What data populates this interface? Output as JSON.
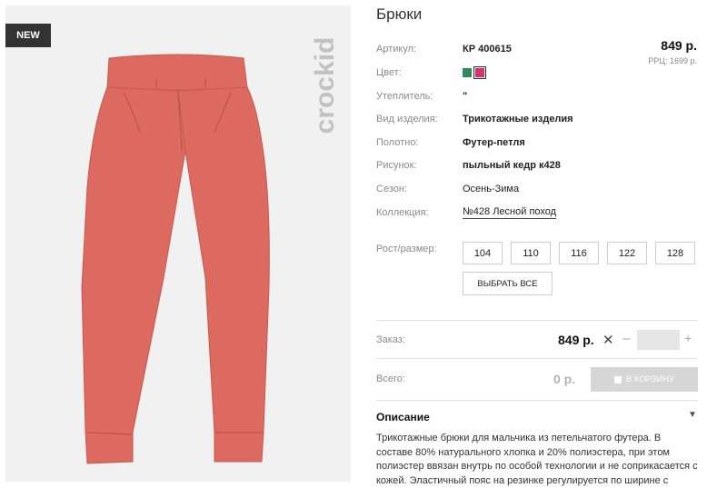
{
  "image": {
    "badge": "NEW",
    "brand_logo": "crockid",
    "pants_color": "#dc6a60"
  },
  "product": {
    "title": "Брюки",
    "price": "849 р.",
    "rrp": "РРЦ: 1699 р.",
    "properties": [
      {
        "label": "Артикул:",
        "value": "КР 400615",
        "style": "bold"
      },
      {
        "label": "Цвет:",
        "value": "",
        "style": "swatches"
      },
      {
        "label": "Утеплитель:",
        "value": "\"",
        "style": "bold"
      },
      {
        "label": "Вид изделия:",
        "value": "Трикотажные изделия",
        "style": "bold"
      },
      {
        "label": "Полотно:",
        "value": "Футер-петля",
        "style": "bold"
      },
      {
        "label": "Рисунок:",
        "value": "пыльный кедр к428",
        "style": "bold"
      },
      {
        "label": "Сезон:",
        "value": "Осень-Зима",
        "style": "normal"
      },
      {
        "label": "Коллекция:",
        "value": "№428 Лесной поход",
        "style": "link"
      }
    ],
    "swatches": [
      {
        "name": "green",
        "color": "#2e8b57",
        "selected": false
      },
      {
        "name": "pink",
        "color": "#e0306a",
        "selected": true
      }
    ]
  },
  "sizes": {
    "label": "Рост/размер:",
    "options": [
      "104",
      "110",
      "116",
      "122",
      "128"
    ],
    "select_all": "ВЫБРАТЬ ВСЕ"
  },
  "order": {
    "label": "Заказ:",
    "price": "849 р.",
    "quantity": ""
  },
  "total": {
    "label": "Всего:",
    "value": "0 р.",
    "cart_button": "В КОРЗИНУ"
  },
  "description": {
    "heading": "Описание",
    "text": "Трикотажные брюки для мальчика из петельчатого футера. В составе 80% натурального хлопка и 20% полиэстера, при этом полиэстер ввязан внутрь по особой технологии и не соприкасается с кожей. Эластичный пояс на резинке регулируется по ширине с"
  }
}
